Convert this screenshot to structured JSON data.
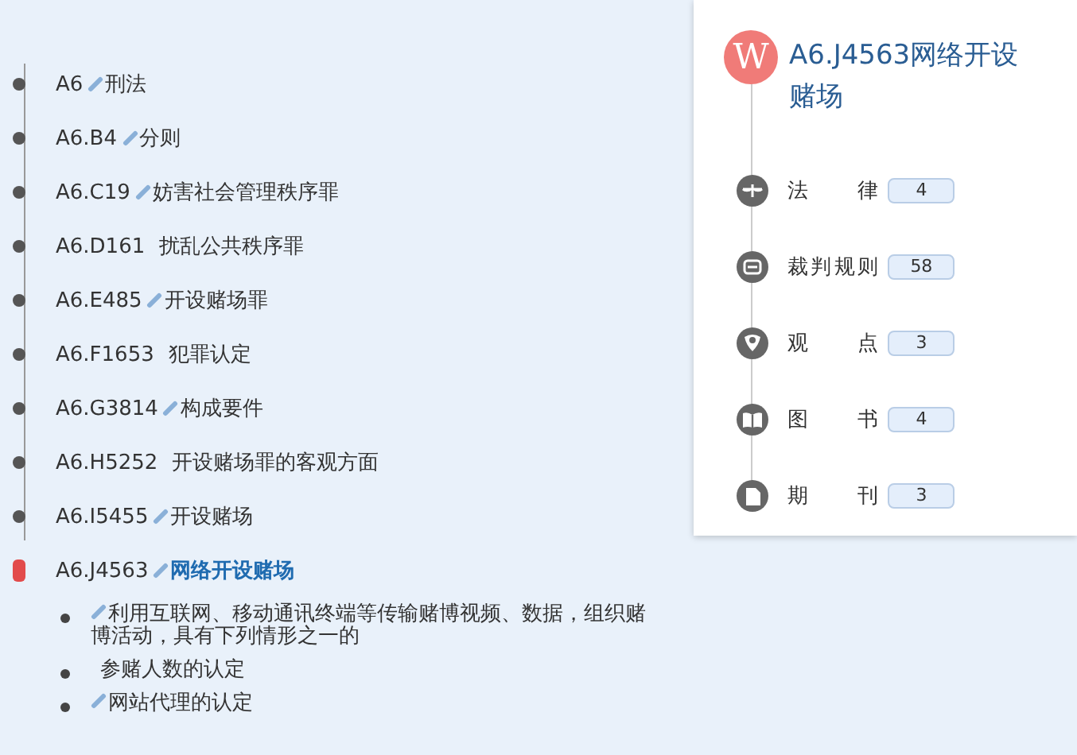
{
  "outline": {
    "items": [
      {
        "code": "A6",
        "linked": true,
        "title": "刑法",
        "selected": false
      },
      {
        "code": "A6.B4",
        "linked": true,
        "title": "分则",
        "selected": false
      },
      {
        "code": "A6.C19",
        "linked": true,
        "title": "妨害社会管理秩序罪",
        "selected": false
      },
      {
        "code": "A6.D161",
        "linked": false,
        "title": "扰乱公共秩序罪",
        "selected": false
      },
      {
        "code": "A6.E485",
        "linked": true,
        "title": "开设赌场罪",
        "selected": false
      },
      {
        "code": "A6.F1653",
        "linked": false,
        "title": "犯罪认定",
        "selected": false
      },
      {
        "code": "A6.G3814",
        "linked": true,
        "title": "构成要件",
        "selected": false
      },
      {
        "code": "A6.H5252",
        "linked": false,
        "title": "开设赌场罪的客观方面",
        "selected": false
      },
      {
        "code": "A6.I5455",
        "linked": true,
        "title": "开设赌场",
        "selected": false
      },
      {
        "code": "A6.J4563",
        "linked": true,
        "title": "网络开设赌场",
        "selected": true,
        "children": [
          {
            "linked": true,
            "title": "利用互联网、移动通讯终端等传输赌博视频、数据，组织赌博活动，具有下列情形之一的"
          },
          {
            "linked": false,
            "title": "参赌人数的认定"
          },
          {
            "linked": true,
            "title": "网站代理的认定"
          }
        ]
      }
    ]
  },
  "detail_panel": {
    "logo": "W",
    "title": "A6.J4563网络开设赌场",
    "categories": [
      {
        "kind": "law",
        "label": "法 律",
        "count": "4"
      },
      {
        "kind": "rule",
        "label": "裁判规则",
        "count": "58"
      },
      {
        "kind": "view",
        "label": "观 点",
        "count": "3"
      },
      {
        "kind": "book",
        "label": "图 书",
        "count": "4"
      },
      {
        "kind": "journal",
        "label": "期 刊",
        "count": "3"
      }
    ]
  }
}
